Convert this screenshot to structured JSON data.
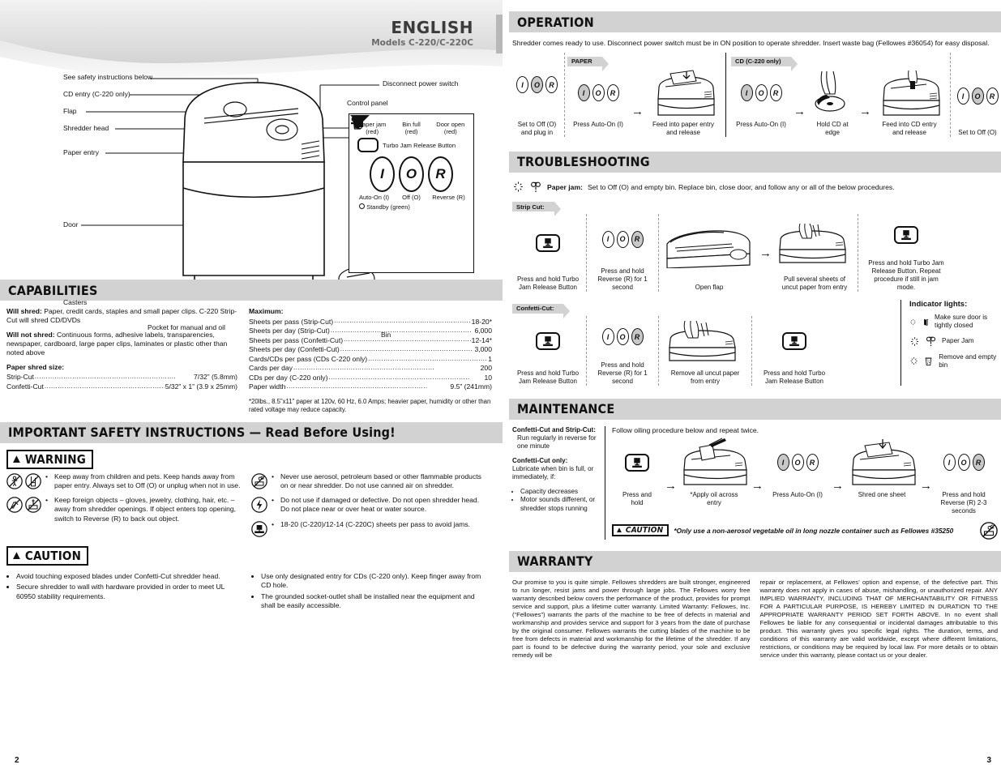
{
  "header": {
    "language": "ENGLISH",
    "models": "Models C-220/C-220C"
  },
  "left_page": {
    "page_number": "2",
    "callouts": [
      "See safety instructions below",
      "CD entry (C-220 only)",
      "Flap",
      "Shredder head",
      "Paper entry",
      "Door",
      "Casters",
      "Pocket for manual and oil",
      "Disconnect power switch",
      "Control panel",
      "Bin"
    ],
    "control_panel": {
      "indicators": [
        {
          "icon": "paper-jam-icon",
          "label": "Paper jam",
          "sub": "(red)"
        },
        {
          "icon": "bin-full-icon",
          "label": "Bin full",
          "sub": "(red)"
        },
        {
          "icon": "door-open-icon",
          "label": "Door open",
          "sub": "(red)"
        }
      ],
      "turbo_label": "Turbo Jam Release Button",
      "buttons": [
        {
          "glyph": "I",
          "label": "Auto-On (I)"
        },
        {
          "glyph": "O",
          "label": "Off (O)"
        },
        {
          "glyph": "R",
          "label": "Reverse (R)"
        }
      ],
      "standby": "Standby (green)"
    },
    "capabilities": {
      "title": "CAPABILITIES",
      "will_shred_label": "Will shred:",
      "will_shred_text": "Paper, credit cards, staples and small paper clips. C-220 Strip-Cut will shred CD/DVDs",
      "will_not_shred_label": "Will not shred:",
      "will_not_shred_text": "Continuous forms, adhesive labels, transparencies, newspaper, cardboard, large paper clips, laminates or plastic other than noted above",
      "shred_size_label": "Paper shred size:",
      "shred_sizes": [
        {
          "name": "Strip-Cut",
          "value": "7/32” (5.8mm)"
        },
        {
          "name": "Confetti-Cut",
          "value": "5/32” x 1” (3.9 x 25mm)"
        }
      ],
      "maximum_label": "Maximum:",
      "maximum": [
        {
          "name": "Sheets per pass (Strip-Cut)",
          "value": "18-20*"
        },
        {
          "name": "Sheets per day (Strip-Cut)",
          "value": "6,000"
        },
        {
          "name": "Sheets per pass (Confetti-Cut)",
          "value": "12-14*"
        },
        {
          "name": "Sheets per day (Confetti-Cut)",
          "value": "3,000"
        },
        {
          "name": "Cards/CDs per pass (CDs C-220 only)",
          "value": "1"
        },
        {
          "name": "Cards per day",
          "value": "200"
        },
        {
          "name": "CDs per day (C-220 only)",
          "value": "10"
        },
        {
          "name": "Paper width",
          "value": "9.5” (241mm)"
        }
      ],
      "footnote": "*20lbs., 8.5”x11” paper at 120v, 60 Hz, 6.0 Amps; heavier paper, humidity or other than rated voltage may reduce capacity."
    },
    "safety": {
      "title": "IMPORTANT SAFETY INSTRUCTIONS — Read Before Using!",
      "warning_label": "WARNING",
      "caution_label": "CAUTION",
      "warning_left": [
        "Keep away from children and pets. Keep hands away from paper entry. Always set to Off (O) or unplug when not in use.",
        "Keep foreign objects – gloves, jewelry, clothing, hair, etc. – away from shredder openings. If object enters top opening, switch to Reverse (R) to back out object."
      ],
      "warning_right": [
        "Never use aerosol, petroleum based or other flammable products on or near shredder. Do not use canned air on shredder.",
        "Do not use if damaged or defective. Do not open shredder head. Do not place near or over heat or water source.",
        "18-20 (C-220)/12-14 (C-220C) sheets per pass to avoid jams."
      ],
      "caution_left": [
        "Avoid touching exposed blades under Confetti-Cut shredder head.",
        "Secure shredder to wall with hardware provided in order to meet UL 60950 stability requirements."
      ],
      "caution_right": [
        "Use only designated entry for CDs (C-220 only). Keep finger away from CD hole.",
        "The grounded socket-outlet shall be installed near the equipment and shall be easily accessible."
      ]
    }
  },
  "right_page": {
    "page_number": "3",
    "operation": {
      "title": "OPERATION",
      "intro": "Shredder comes ready to use. Disconnect power switch must be in ON position to operate shredder. Insert waste bag (Fellowes #36054) for easy disposal.",
      "tag_paper": "PAPER",
      "tag_cd": "CD (C-220 only)",
      "steps": [
        {
          "caption": "Set to Off (O) and plug in",
          "mode": "O"
        },
        {
          "caption": "Press Auto-On (I)",
          "mode": "I"
        },
        {
          "caption": "Feed into paper entry and release",
          "mode": "art-paper"
        },
        {
          "caption": "Press Auto-On (I)",
          "mode": "I"
        },
        {
          "caption": "Hold CD at edge",
          "mode": "art-hand-cd"
        },
        {
          "caption": "Feed into CD entry and release",
          "mode": "art-cd"
        },
        {
          "caption": "Set to Off (O)",
          "mode": "O"
        }
      ]
    },
    "troubleshooting": {
      "title": "TROUBLESHOOTING",
      "paper_jam_label": "Paper jam:",
      "paper_jam_text": "Set to Off (O) and empty bin. Replace bin, close door, and follow any or all of the below procedures.",
      "tag_strip": "Strip Cut:",
      "tag_confetti": "Confetti-Cut:",
      "strip_steps": [
        {
          "caption": "Press and hold Turbo Jam Release Button",
          "mode": "turbo"
        },
        {
          "caption": "Press and hold Reverse (R) for 1 second",
          "mode": "R"
        },
        {
          "caption": "Open flap",
          "mode": "art-flap"
        },
        {
          "caption": "Pull several sheets of uncut paper from entry",
          "mode": "art-pull"
        },
        {
          "caption": "Press and hold Turbo Jam Release Button. Repeat procedure if still in jam mode.",
          "mode": "turbo"
        }
      ],
      "confetti_steps": [
        {
          "caption": "Press and hold Turbo Jam Release Button",
          "mode": "turbo"
        },
        {
          "caption": "Press and hold Reverse (R) for 1 second",
          "mode": "R"
        },
        {
          "caption": "Remove all uncut paper from entry",
          "mode": "art-pull"
        },
        {
          "caption": "Press and hold Turbo Jam Release Button",
          "mode": "turbo"
        }
      ],
      "indicator_title": "Indicator lights:",
      "indicators": [
        {
          "icon": "door-open-icon",
          "text": "Make sure door is tightly closed"
        },
        {
          "icon": "paper-jam-icon",
          "text": "Paper Jam"
        },
        {
          "icon": "bin-full-icon",
          "text": "Remove and empty bin"
        }
      ]
    },
    "maintenance": {
      "title": "MAINTENANCE",
      "left_heading_1": "Confetti-Cut and Strip-Cut:",
      "left_text_1": "Run regularly in reverse for one minute",
      "left_heading_2": "Confetti-Cut only:",
      "left_text_2": "Lubricate when bin is full, or immediately, if:",
      "left_bullets": [
        "Capacity decreases",
        "Motor sounds different, or shredder stops running"
      ],
      "right_intro": "Follow oiling procedure below and repeat twice.",
      "steps": [
        {
          "caption": "Press and hold",
          "mode": "turbo"
        },
        {
          "caption": "*Apply oil across entry",
          "mode": "art-oil"
        },
        {
          "caption": "Press Auto-On (I)",
          "mode": "I"
        },
        {
          "caption": "Shred one sheet",
          "mode": "art-paper"
        },
        {
          "caption": "Press and hold Reverse (R) 2-3 seconds",
          "mode": "R"
        }
      ],
      "caution_label": "CAUTION",
      "caution_text": "*Only use a non-aerosol vegetable oil in long nozzle container such as Fellowes #35250"
    },
    "warranty": {
      "title": "WARRANTY",
      "col1": "Our promise to you is quite simple.  Fellowes shredders are built stronger, engineered to run longer, resist jams and power through large jobs.  The Fellowes worry free warranty described below covers the performance of the product, provides for prompt service and support, plus a lifetime cutter warranty. Limited Warranty:  Fellowes, Inc. (“Fellowes”) warrants the parts of the machine to be free of defects in material and workmanship and provides service and support for 3 years from the date of purchase by the original consumer.  Fellowes warrants the cutting blades of the machine to be free from defects in material and workmanship for the lifetime of the shredder. If any part is found to be defective during the warranty period, your sole and exclusive remedy will be",
      "col2": "repair or replacement, at Fellowes’ option and expense, of the defective part. This warranty does not apply in cases of abuse, mishandling, or unauthorized repair. ANY IMPLIED WARRANTY, INCLUDING THAT OF MERCHANTABILITY OR FITNESS FOR A PARTICULAR PURPOSE, IS HEREBY LIMITED IN DURATION TO THE APPROPRIATE WARRANTY PERIOD SET FORTH ABOVE. In no event shall Fellowes be liable for any consequential or incidental damages attributable to this product. This warranty gives you specific legal rights. The duration, terms, and conditions of this warranty are valid worldwide, except where different limitations, restrictions, or conditions may be required by local law. For more details or to obtain service under this warranty, please contact us or your dealer."
    }
  },
  "colors": {
    "section_bar": "#d2d2d2",
    "ink": "#111111",
    "swoosh": "#dcdcdc"
  }
}
